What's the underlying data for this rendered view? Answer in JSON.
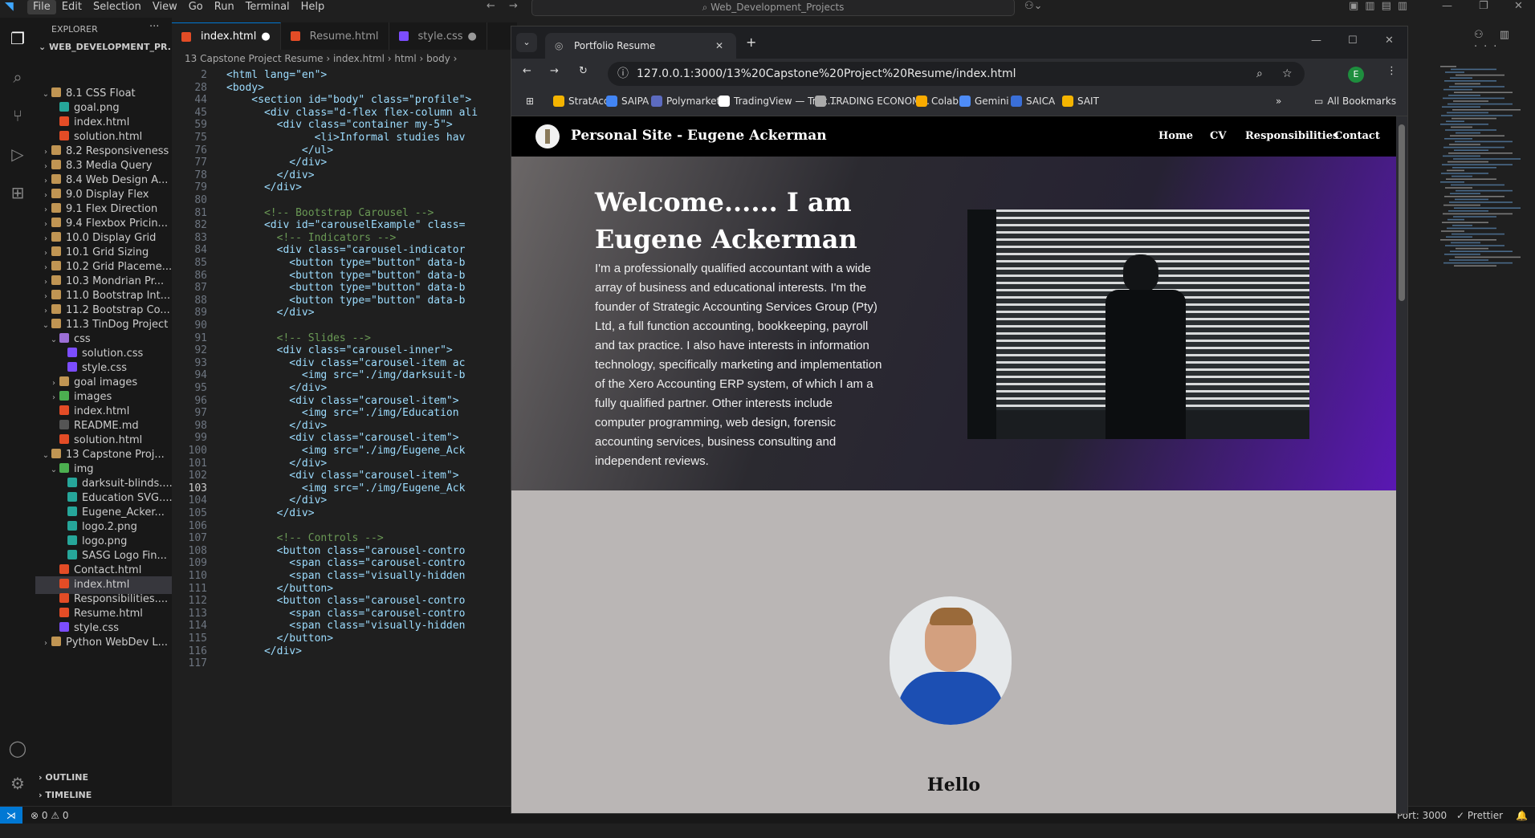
{
  "vscode": {
    "menu": [
      "File",
      "Edit",
      "Selection",
      "View",
      "Go",
      "Run",
      "Terminal",
      "Help"
    ],
    "search_title": "Web_Development_Projects",
    "explorer_title": "EXPLORER",
    "workspace": "WEB_DEVELOPMENT_PR...",
    "tree": [
      {
        "label": "8.1 CSS Float",
        "kind": "folder",
        "level": 1,
        "open": true
      },
      {
        "label": "goal.png",
        "kind": "img",
        "level": 2
      },
      {
        "label": "index.html",
        "kind": "html",
        "level": 2
      },
      {
        "label": "solution.html",
        "kind": "html",
        "level": 2
      },
      {
        "label": "8.2 Responsiveness",
        "kind": "folder",
        "level": 1
      },
      {
        "label": "8.3 Media Query",
        "kind": "folder",
        "level": 1
      },
      {
        "label": "8.4 Web Design A...",
        "kind": "folder",
        "level": 1
      },
      {
        "label": "9.0 Display Flex",
        "kind": "folder",
        "level": 1
      },
      {
        "label": "9.1 Flex Direction",
        "kind": "folder",
        "level": 1
      },
      {
        "label": "9.4 Flexbox Pricin...",
        "kind": "folder",
        "level": 1
      },
      {
        "label": "10.0 Display Grid",
        "kind": "folder",
        "level": 1
      },
      {
        "label": "10.1 Grid Sizing",
        "kind": "folder",
        "level": 1
      },
      {
        "label": "10.2 Grid Placeme...",
        "kind": "folder",
        "level": 1
      },
      {
        "label": "10.3 Mondrian Pr...",
        "kind": "folder",
        "level": 1
      },
      {
        "label": "11.0 Bootstrap Int...",
        "kind": "folder",
        "level": 1
      },
      {
        "label": "11.2 Bootstrap Co...",
        "kind": "folder",
        "level": 1
      },
      {
        "label": "11.3 TinDog Project",
        "kind": "folder",
        "level": 1,
        "open": true
      },
      {
        "label": "css",
        "kind": "folder-purple",
        "level": 2,
        "open": true
      },
      {
        "label": "solution.css",
        "kind": "css",
        "level": 3
      },
      {
        "label": "style.css",
        "kind": "css",
        "level": 3
      },
      {
        "label": "goal images",
        "kind": "folder",
        "level": 2
      },
      {
        "label": "images",
        "kind": "folder-green",
        "level": 2
      },
      {
        "label": "index.html",
        "kind": "html",
        "level": 2
      },
      {
        "label": "README.md",
        "kind": "md",
        "level": 2
      },
      {
        "label": "solution.html",
        "kind": "html",
        "level": 2
      },
      {
        "label": "13 Capstone Proj...",
        "kind": "folder",
        "level": 1,
        "open": true
      },
      {
        "label": "img",
        "kind": "folder-green",
        "level": 2,
        "open": true
      },
      {
        "label": "darksuit-blinds....",
        "kind": "img",
        "level": 3
      },
      {
        "label": "Education SVG....",
        "kind": "img",
        "level": 3
      },
      {
        "label": "Eugene_Acker...",
        "kind": "img",
        "level": 3
      },
      {
        "label": "logo.2.png",
        "kind": "img",
        "level": 3
      },
      {
        "label": "logo.png",
        "kind": "img",
        "level": 3
      },
      {
        "label": "SASG Logo Fin...",
        "kind": "img",
        "level": 3
      },
      {
        "label": "Contact.html",
        "kind": "html",
        "level": 2
      },
      {
        "label": "index.html",
        "kind": "html",
        "level": 2,
        "selected": true
      },
      {
        "label": "Responsibilities....",
        "kind": "html",
        "level": 2
      },
      {
        "label": "Resume.html",
        "kind": "html",
        "level": 2
      },
      {
        "label": "style.css",
        "kind": "css",
        "level": 2
      },
      {
        "label": "Python WebDev L...",
        "kind": "folder",
        "level": 1
      }
    ],
    "outline": "OUTLINE",
    "timeline": "TIMELINE",
    "tabs": [
      "index.html",
      "Resume.html",
      "style.css"
    ],
    "breadcrumb": "13 Capstone Project Resume  ›  index.html  ›  html  ›  body  ›",
    "code_lines": [
      {
        "n": "2",
        "t": "<html lang=\"en\">"
      },
      {
        "n": "28",
        "t": "<body>"
      },
      {
        "n": "44",
        "t": "    <section id=\"body\" class=\"profile\">"
      },
      {
        "n": "45",
        "t": "      <div class=\"d-flex flex-column ali"
      },
      {
        "n": "59",
        "t": "        <div class=\"container my-5\">"
      },
      {
        "n": "75",
        "t": "              <li>Informal studies hav"
      },
      {
        "n": "76",
        "t": "            </ul>"
      },
      {
        "n": "77",
        "t": "          </div>"
      },
      {
        "n": "78",
        "t": "        </div>"
      },
      {
        "n": "79",
        "t": "      </div>"
      },
      {
        "n": "80",
        "t": ""
      },
      {
        "n": "81",
        "t": "      <!-- Bootstrap Carousel -->"
      },
      {
        "n": "82",
        "t": "      <div id=\"carouselExample\" class="
      },
      {
        "n": "83",
        "t": "        <!-- Indicators -->"
      },
      {
        "n": "84",
        "t": "        <div class=\"carousel-indicator"
      },
      {
        "n": "85",
        "t": "          <button type=\"button\" data-b"
      },
      {
        "n": "86",
        "t": "          <button type=\"button\" data-b"
      },
      {
        "n": "87",
        "t": "          <button type=\"button\" data-b"
      },
      {
        "n": "88",
        "t": "          <button type=\"button\" data-b"
      },
      {
        "n": "89",
        "t": "        </div>"
      },
      {
        "n": "90",
        "t": ""
      },
      {
        "n": "91",
        "t": "        <!-- Slides -->"
      },
      {
        "n": "92",
        "t": "        <div class=\"carousel-inner\">"
      },
      {
        "n": "93",
        "t": "          <div class=\"carousel-item ac"
      },
      {
        "n": "94",
        "t": "            <img src=\"./img/darksuit-b"
      },
      {
        "n": "95",
        "t": "          </div>"
      },
      {
        "n": "96",
        "t": "          <div class=\"carousel-item\">"
      },
      {
        "n": "97",
        "t": "            <img src=\"./img/Education"
      },
      {
        "n": "98",
        "t": "          </div>"
      },
      {
        "n": "99",
        "t": "          <div class=\"carousel-item\">"
      },
      {
        "n": "100",
        "t": "            <img src=\"./img/Eugene_Ack"
      },
      {
        "n": "101",
        "t": "          </div>"
      },
      {
        "n": "102",
        "t": "          <div class=\"carousel-item\">"
      },
      {
        "n": "103",
        "t": "            <img src=\"./img/Eugene_Ack"
      },
      {
        "n": "104",
        "t": "          </div>"
      },
      {
        "n": "105",
        "t": "        </div>"
      },
      {
        "n": "106",
        "t": ""
      },
      {
        "n": "107",
        "t": "        <!-- Controls -->"
      },
      {
        "n": "108",
        "t": "        <button class=\"carousel-contro"
      },
      {
        "n": "109",
        "t": "          <span class=\"carousel-contro"
      },
      {
        "n": "110",
        "t": "          <span class=\"visually-hidden"
      },
      {
        "n": "111",
        "t": "        </button>"
      },
      {
        "n": "112",
        "t": "        <button class=\"carousel-contro"
      },
      {
        "n": "113",
        "t": "          <span class=\"carousel-contro"
      },
      {
        "n": "114",
        "t": "          <span class=\"visually-hidden"
      },
      {
        "n": "115",
        "t": "        </button>"
      },
      {
        "n": "116",
        "t": "      </div>"
      },
      {
        "n": "117",
        "t": ""
      }
    ],
    "status": {
      "errors": "0",
      "warnings": "0",
      "port": "Port: 3000",
      "prettier": "Prettier"
    }
  },
  "browser": {
    "tab_title": "Portfolio Resume",
    "url": "127.0.0.1:3000/13%20Capstone%20Project%20Resume/index.html",
    "profile_initial": "E",
    "bookmarks": [
      "StratAcc",
      "SAIPA",
      "Polymarket",
      "TradingView — Trac...",
      "TRADING ECONOM...",
      "Colab",
      "Gemini",
      "SAICA",
      "SAIT"
    ],
    "all_bookmarks": "All Bookmarks"
  },
  "site": {
    "brand": "Personal Site - Eugene Ackerman",
    "nav": [
      "Home",
      "CV",
      "Responsibilities",
      "Contact"
    ],
    "hero_title": "Welcome...... I am Eugene Ackerman",
    "hero_text": "I'm a professionally qualified accountant with a wide array of business and educational interests. I'm the founder of Strategic Accounting Services Group (Pty) Ltd, a full function accounting, bookkeeping, payroll and tax practice. I also have interests in information technology, specifically marketing and implementation of the Xero Accounting ERP system, of which I am a fully qualified partner. Other interests include computer programming, web design, forensic accounting services, business consulting and independent reviews.",
    "hello": "Hello"
  }
}
